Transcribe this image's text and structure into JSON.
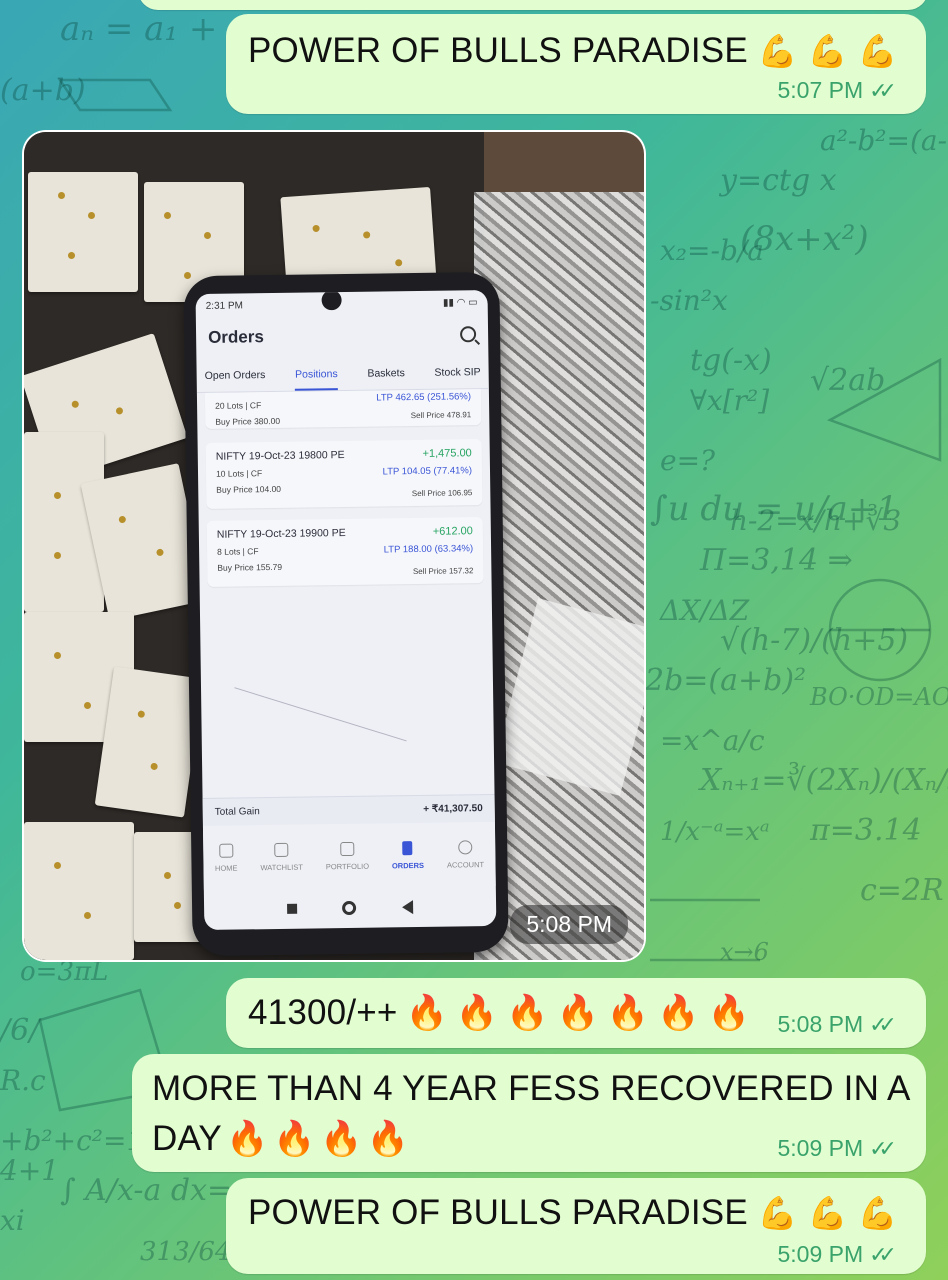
{
  "messages": [
    {
      "text": "POWER OF BULLS PARADISE",
      "emoji": [
        "💪",
        "💪",
        "💪"
      ],
      "time": "5:07 PM"
    },
    {
      "text": "41300/++",
      "emoji": [
        "🔥",
        "🔥",
        "🔥",
        "🔥",
        "🔥",
        "🔥",
        "🔥"
      ],
      "time": "5:08 PM"
    },
    {
      "text": "MORE THAN 4 YEAR FESS RECOVERED IN A DAY",
      "emoji": [
        "🔥",
        "🔥",
        "🔥",
        "🔥"
      ],
      "time": "5:09 PM"
    },
    {
      "text": "POWER OF BULLS PARADISE",
      "emoji": [
        "💪",
        "💪",
        "💪"
      ],
      "time": "5:09 PM"
    }
  ],
  "photo": {
    "time": "5:08 PM",
    "phone": {
      "status_time": "2:31 PM",
      "title": "Orders",
      "tabs": [
        "Open Orders",
        "Positions",
        "Baskets",
        "Stock SIP"
      ],
      "active_tab": "Positions",
      "positions": [
        {
          "name": "",
          "pnl": "",
          "lots": "20 Lots | CF",
          "ltp": "LTP 462.65 (251.56%)",
          "buy": "Buy Price 380.00",
          "sell": "Sell Price 478.91"
        },
        {
          "name": "NIFTY 19-Oct-23 19800 PE",
          "pnl": "+1,475.00",
          "lots": "10 Lots | CF",
          "ltp": "LTP 104.05 (77.41%)",
          "buy": "Buy Price 104.00",
          "sell": "Sell Price 106.95"
        },
        {
          "name": "NIFTY 19-Oct-23 19900 PE",
          "pnl": "+612.00",
          "lots": "8 Lots | CF",
          "ltp": "LTP 188.00 (63.34%)",
          "buy": "Buy Price 155.79",
          "sell": "Sell Price 157.32"
        }
      ],
      "total_label": "Total Gain",
      "total_value": "+ ₹41,307.50",
      "nav": [
        "HOME",
        "WATCHLIST",
        "PORTFOLIO",
        "ORDERS",
        "ACCOUNT"
      ],
      "active_nav": "ORDERS"
    }
  },
  "colors": {
    "bubble": "#e2fdd0",
    "time_text": "#3aa36b",
    "accent_blue": "#3a55d6",
    "gain_green": "#2aa564"
  },
  "icons": [
    "double-check-icon",
    "flexed-biceps-emoji",
    "fire-emoji",
    "search-icon",
    "home-icon",
    "watchlist-icon",
    "portfolio-icon",
    "orders-icon",
    "account-icon"
  ]
}
